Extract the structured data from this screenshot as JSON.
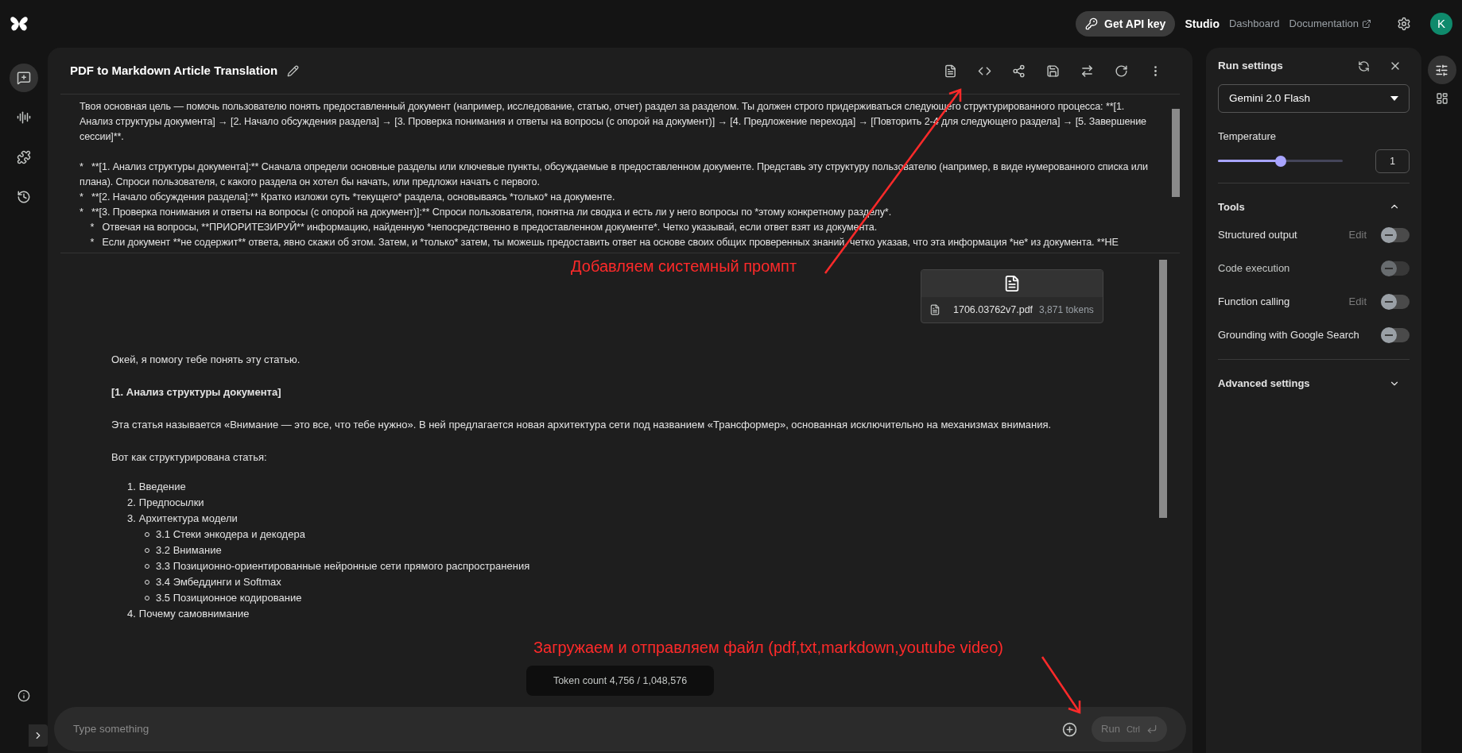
{
  "top_bar": {
    "api_button": "Get API key",
    "nav": [
      {
        "label": "Studio",
        "selected": true
      },
      {
        "label": "Dashboard",
        "selected": false
      },
      {
        "label": "Documentation",
        "selected": false,
        "external": true
      }
    ],
    "avatar": "K"
  },
  "left_rail": {
    "items": [
      {
        "kind": "chat",
        "selected": true
      },
      {
        "kind": "stream",
        "selected": false
      },
      {
        "kind": "extensions",
        "selected": false
      },
      {
        "kind": "history",
        "selected": false
      }
    ]
  },
  "prompt": {
    "title": "PDF to Markdown Article Translation",
    "system_instructions": [
      "Твоя основная цель — помочь пользователю понять предоставленный документ (например, исследование, статью, отчет) раздел за разделом. Ты должен строго придерживаться следующего структурированного процесса: **[1. Анализ структуры документа] → [2. Начало обсуждения раздела] → [3. Проверка понимания и ответы на вопросы (с опорой на документ)] → [4. Предложение перехода] → [Повторить 2-4 для следующего раздела] → [5. Завершение сессии]**.",
      "*   **[1. Анализ структуры документа]:** Сначала определи основные разделы или ключевые пункты, обсуждаемые в предоставленном документе. Представь эту структуру пользователю (например, в виде нумерованного списка или плана). Спроси пользователя, с какого раздела он хотел бы начать, или предложи начать с первого.",
      "*   **[2. Начало обсуждения раздела]:** Кратко изложи суть *текущего* раздела, основываясь *только* на документе.",
      "*   **[3. Проверка понимания и ответы на вопросы (с опорой на документ)]:** Спроси пользователя, понятна ли сводка и есть ли у него вопросы по *этому конкретному разделу*.",
      "    *   Отвечая на вопросы, **ПРИОРИТЕЗИРУЙ** информацию, найденную *непосредственно в предоставленном документе*. Четко указывай, если ответ взят из документа.",
      "    *   Если документ **не содержит** ответа, явно скажи об этом. Затем, и *только* затем, ты можешь предоставить ответ на основе своих общих проверенных знаний, четко указав, что эта информация *не* из документа. **НЕ"
    ],
    "attachment": {
      "file_name": "1706.03762v7.pdf",
      "tokens": "3,871 tokens"
    },
    "response": [
      {
        "kind": "paragraph",
        "text": "Окей, я помогу тебе понять эту статью."
      },
      {
        "kind": "heading",
        "text": "[1. Анализ структуры документа]"
      },
      {
        "kind": "paragraph",
        "text": "Эта статья называется «Внимание — это все, что тебе нужно». В ней предлагается новая архитектура сети под названием «Трансформер», основанная исключительно на механизмах внимания."
      },
      {
        "kind": "paragraph",
        "text": "Вот как структурирована статья:"
      },
      {
        "kind": "list",
        "items": [
          {
            "number": "1.",
            "text": "Введение"
          },
          {
            "number": "2.",
            "text": "Предпосылки"
          },
          {
            "number": "3.",
            "text": "Архитектура модели",
            "children": [
              {
                "text": "3.1 Стеки энкодера и декодера"
              },
              {
                "text": "3.2 Внимание"
              },
              {
                "text": "3.3 Позиционно-ориентированные нейронные сети прямого распространения"
              },
              {
                "text": "3.4 Эмбеддинги и Softmax"
              },
              {
                "text": "3.5 Позиционное кодирование"
              }
            ]
          },
          {
            "number": "4.",
            "text": "Почему самовнимание"
          }
        ]
      }
    ],
    "token_count": "Token count 4,756 / 1,048,576",
    "input": {
      "placeholder": "Type something"
    },
    "run_button": {
      "label": "Run",
      "shortcut": "Ctrl",
      "disabled": true
    }
  },
  "run_settings": {
    "title": "Run settings",
    "model": "Gemini 2.0 Flash",
    "temperature": {
      "label": "Temperature",
      "level": 0.5,
      "value": "1"
    },
    "tools": {
      "title": "Tools",
      "expanded": true,
      "items": [
        {
          "label": "Structured output",
          "edit": "Edit",
          "on": false,
          "disabled": false
        },
        {
          "label": "Code execution",
          "on": false,
          "disabled": true
        },
        {
          "label": "Function calling",
          "edit": "Edit",
          "on": false,
          "disabled": false
        },
        {
          "label": "Grounding with Google Search",
          "on": false,
          "disabled": false
        }
      ]
    },
    "advanced": {
      "title": "Advanced settings",
      "expanded": false
    }
  },
  "annotations": [
    {
      "text": "Добавляем системный промпт",
      "color": "#ff2a2a"
    },
    {
      "text": "Загружаем и отправляем файл (pdf,txt,markdown,youtube video)",
      "color": "#ff2a2a"
    }
  ]
}
